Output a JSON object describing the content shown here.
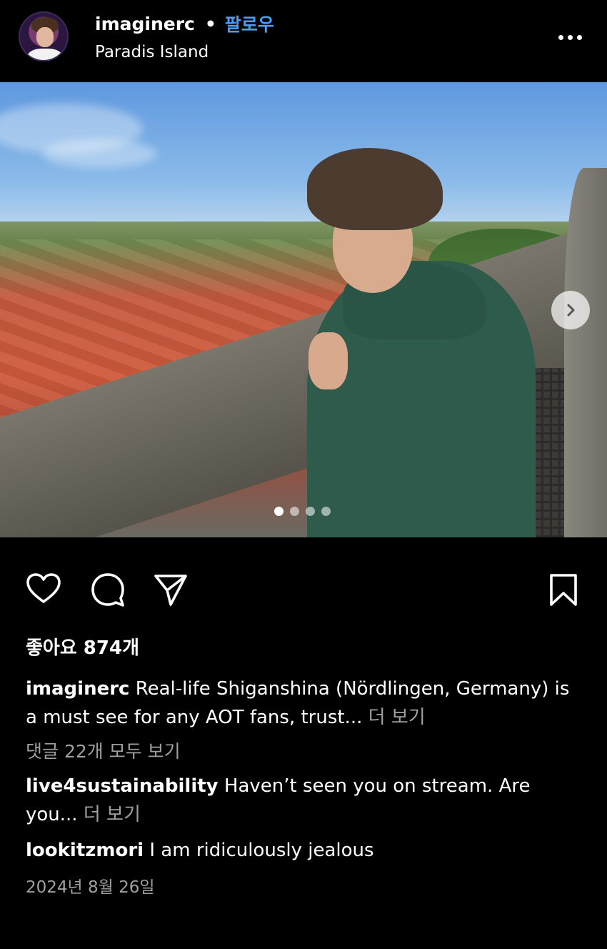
{
  "header": {
    "username": "imaginerc",
    "separator": "•",
    "follow_label": "팔로우",
    "location": "Paradis Island"
  },
  "carousel": {
    "total_slides": 4,
    "current_slide": 1
  },
  "likes": {
    "label": "좋아요 874개"
  },
  "caption": {
    "username": "imaginerc",
    "text": "Real-life Shiganshina (Nördlingen, Germany) is a must see for any AOT fans, trust...",
    "more_label": "더 보기"
  },
  "comments": {
    "view_all_label": "댓글 22개 모두 보기",
    "items": [
      {
        "username": "live4sustainability",
        "text": "Haven’t seen you on stream. Are you...",
        "more_label": "더 보기"
      },
      {
        "username": "lookitzmori",
        "text": "I am ridiculously jealous"
      }
    ]
  },
  "date": "2024년 8월 26일",
  "icons": {
    "like": "heart-icon",
    "comment": "comment-icon",
    "share": "send-icon",
    "save": "bookmark-icon",
    "more": "more-icon",
    "next": "chevron-right-icon"
  },
  "colors": {
    "background": "#000000",
    "text": "#ffffff",
    "follow": "#4a9df8",
    "muted": "#a0a0a0"
  }
}
